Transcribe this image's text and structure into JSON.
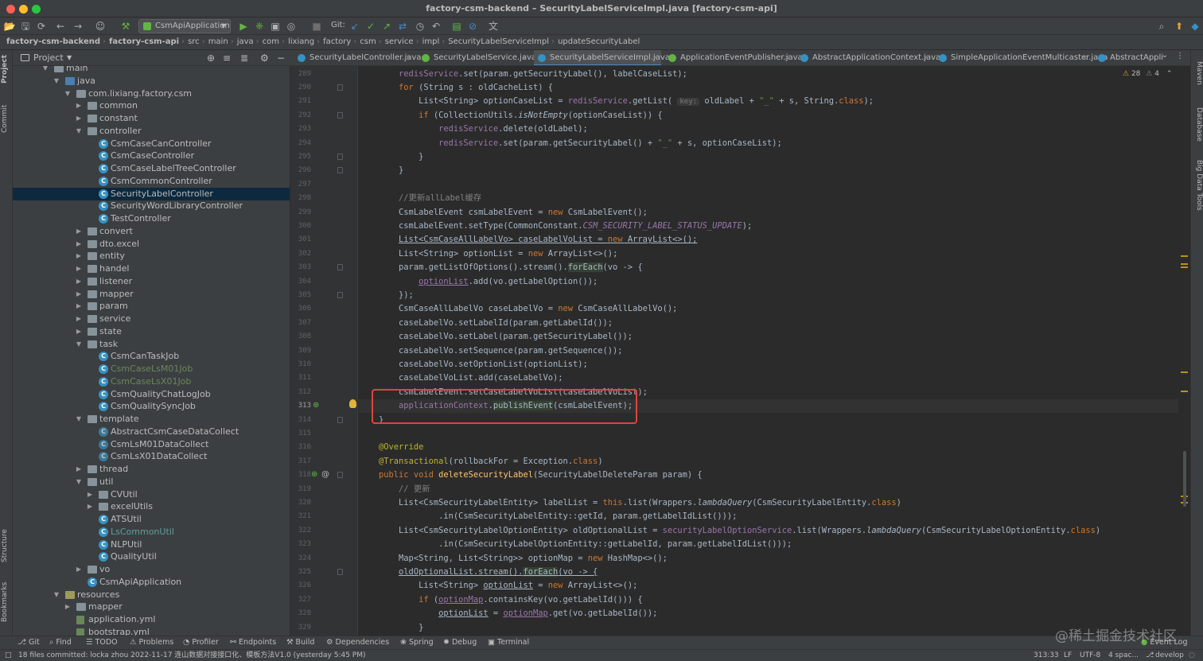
{
  "window": {
    "title": "factory-csm-backend – SecurityLabelServiceImpl.java [factory-csm-api]"
  },
  "toolbar": {
    "run_config": "CsmApiApplication",
    "git_label": "Git:"
  },
  "breadcrumbs": [
    "factory-csm-backend",
    "factory-csm-api",
    "src",
    "main",
    "java",
    "com",
    "lixiang",
    "factory",
    "csm",
    "service",
    "impl",
    "SecurityLabelServiceImpl",
    "updateSecurityLabel"
  ],
  "project": {
    "header": "Project",
    "tree": [
      {
        "label": "main",
        "kind": "folder",
        "level": 3
      },
      {
        "label": "java",
        "kind": "src",
        "level": 4
      },
      {
        "label": "com.lixiang.factory.csm",
        "kind": "folder",
        "level": 5
      },
      {
        "label": "common",
        "kind": "folder",
        "level": 6
      },
      {
        "label": "constant",
        "kind": "folder",
        "level": 6
      },
      {
        "label": "controller",
        "kind": "folder",
        "level": 6
      },
      {
        "label": "CsmCaseCanController",
        "kind": "class",
        "level": 7
      },
      {
        "label": "CsmCaseController",
        "kind": "class",
        "level": 7
      },
      {
        "label": "CsmCaseLabelTreeController",
        "kind": "class",
        "level": 7
      },
      {
        "label": "CsmCommonController",
        "kind": "class",
        "level": 7
      },
      {
        "label": "SecurityLabelController",
        "kind": "class",
        "level": 7,
        "selected": true
      },
      {
        "label": "SecurityWordLibraryController",
        "kind": "class",
        "level": 7
      },
      {
        "label": "TestController",
        "kind": "class",
        "level": 7
      },
      {
        "label": "convert",
        "kind": "folder",
        "level": 6
      },
      {
        "label": "dto.excel",
        "kind": "folder",
        "level": 6
      },
      {
        "label": "entity",
        "kind": "folder",
        "level": 6
      },
      {
        "label": "handel",
        "kind": "folder",
        "level": 6
      },
      {
        "label": "listener",
        "kind": "folder",
        "level": 6
      },
      {
        "label": "mapper",
        "kind": "folder",
        "level": 6
      },
      {
        "label": "param",
        "kind": "folder",
        "level": 6
      },
      {
        "label": "service",
        "kind": "folder",
        "level": 6
      },
      {
        "label": "state",
        "kind": "folder",
        "level": 6
      },
      {
        "label": "task",
        "kind": "folder",
        "level": 6
      },
      {
        "label": "CsmCanTaskJob",
        "kind": "class",
        "level": 7
      },
      {
        "label": "CsmCaseLsM01Job",
        "kind": "class",
        "level": 7,
        "color": "green"
      },
      {
        "label": "CsmCaseLsX01Job",
        "kind": "class",
        "level": 7,
        "color": "green"
      },
      {
        "label": "CsmQualityChatLogJob",
        "kind": "class",
        "level": 7
      },
      {
        "label": "CsmQualitySyncJob",
        "kind": "class",
        "level": 7
      },
      {
        "label": "template",
        "kind": "folder",
        "level": 6
      },
      {
        "label": "AbstractCsmCaseDataCollect",
        "kind": "abstract",
        "level": 7
      },
      {
        "label": "CsmLsM01DataCollect",
        "kind": "abstract",
        "level": 7
      },
      {
        "label": "CsmLsX01DataCollect",
        "kind": "abstract",
        "level": 7
      },
      {
        "label": "thread",
        "kind": "folder",
        "level": 6
      },
      {
        "label": "util",
        "kind": "folder",
        "level": 6
      },
      {
        "label": "CVUtil",
        "kind": "folder",
        "level": 7
      },
      {
        "label": "excelUtils",
        "kind": "folder",
        "level": 7
      },
      {
        "label": "ATSUtil",
        "kind": "class",
        "level": 7
      },
      {
        "label": "LsCommonUtil",
        "kind": "class",
        "level": 7,
        "color": "teal"
      },
      {
        "label": "NLPUtil",
        "kind": "class",
        "level": 7
      },
      {
        "label": "QualityUtil",
        "kind": "class",
        "level": 7
      },
      {
        "label": "vo",
        "kind": "folder",
        "level": 6
      },
      {
        "label": "CsmApiApplication",
        "kind": "class",
        "level": 6
      },
      {
        "label": "resources",
        "kind": "res",
        "level": 4
      },
      {
        "label": "mapper",
        "kind": "folder",
        "level": 5
      },
      {
        "label": "application.yml",
        "kind": "yml",
        "level": 5
      },
      {
        "label": "bootstrap.yml",
        "kind": "yml",
        "level": 5
      }
    ]
  },
  "tabs": [
    {
      "label": "SecurityLabelController.java",
      "icon": "class"
    },
    {
      "label": "SecurityLabelService.java",
      "icon": "interface"
    },
    {
      "label": "SecurityLabelServiceImpl.java",
      "icon": "class",
      "active": true
    },
    {
      "label": "ApplicationEventPublisher.java",
      "icon": "interface"
    },
    {
      "label": "AbstractApplicationContext.java",
      "icon": "class"
    },
    {
      "label": "SimpleApplicationEventMulticaster.java",
      "icon": "class"
    },
    {
      "label": "AbstractAppli",
      "icon": "class"
    }
  ],
  "inspections": {
    "warnings": "28",
    "weak": "4"
  },
  "editor": {
    "current_line": 313,
    "lines": [
      {
        "n": 289,
        "html": "        <span class='fld'>redisService</span>.set(param.getSecurityLabel(), labelCaseList);"
      },
      {
        "n": 290,
        "html": "        <span class='kw'>for</span> (String s : oldCacheList) {"
      },
      {
        "n": 291,
        "html": "            List&lt;String&gt; optionCaseList = <span class='fld'>redisService</span>.getList( <span class='hint'>key:</span> oldLabel + <span class='str'>\"_\"</span> + s, String.<span class='kw'>class</span>);"
      },
      {
        "n": 292,
        "html": "            <span class='kw'>if</span> (CollectionUtils.<span class='sti'>isNotEmpty</span>(optionCaseList)) {"
      },
      {
        "n": 293,
        "html": "                <span class='fld'>redisService</span>.delete(oldLabel);"
      },
      {
        "n": 294,
        "html": "                <span class='fld'>redisService</span>.set(param.getSecurityLabel() + <span class='str'>\"_\"</span> + s, optionCaseList);"
      },
      {
        "n": 295,
        "html": "            }"
      },
      {
        "n": 296,
        "html": "        }"
      },
      {
        "n": 297,
        "html": ""
      },
      {
        "n": 298,
        "html": "        <span class='cmt'>//更新allLabel缓存</span>"
      },
      {
        "n": 299,
        "html": "        CsmLabelEvent csmLabelEvent = <span class='kw'>new</span> CsmLabelEvent();"
      },
      {
        "n": 300,
        "html": "        csmLabelEvent.setType(CommonConstant.<span class='fldi'>CSM_SECURITY_LABEL_STATUS_UPDATE</span>);"
      },
      {
        "n": 301,
        "html": "        <span class='und'>List&lt;CsmCaseAllLabelVo&gt; caseLabelVoList = <span class='kw'>new</span> ArrayList&lt;&gt;();</span>"
      },
      {
        "n": 302,
        "html": "        List&lt;String&gt; optionList = <span class='kw'>new</span> ArrayList&lt;&gt;();"
      },
      {
        "n": 303,
        "html": "        param.getListOfOptions().stream().<span class='hl'>forEach</span>(vo -&gt; {"
      },
      {
        "n": 304,
        "html": "            <span class='fld und'>optionList</span>.add(vo.getLabelOption());"
      },
      {
        "n": 305,
        "html": "        });"
      },
      {
        "n": 306,
        "html": "        CsmCaseAllLabelVo caseLabelVo = <span class='kw'>new</span> CsmCaseAllLabelVo();"
      },
      {
        "n": 307,
        "html": "        caseLabelVo.setLabelId(param.getLabelId());"
      },
      {
        "n": 308,
        "html": "        caseLabelVo.setLabel(param.getSecurityLabel());"
      },
      {
        "n": 309,
        "html": "        caseLabelVo.setSequence(param.getSequence());"
      },
      {
        "n": 310,
        "html": "        caseLabelVo.setOptionList(optionList);"
      },
      {
        "n": 311,
        "html": "        caseLabelVoList.add(caseLabelVo);"
      },
      {
        "n": 312,
        "html": "        csmLabelEvent.setCaseLabelVoList(caseLabelVoList);"
      },
      {
        "n": 313,
        "html": "        <span class='fld'>applicationContext</span>.<span class='hl'>publishEvent</span>(csmLabelEvent);"
      },
      {
        "n": 314,
        "html": "    }"
      },
      {
        "n": 315,
        "html": ""
      },
      {
        "n": 316,
        "html": "    <span class='ann'>@Override</span>"
      },
      {
        "n": 317,
        "html": "    <span class='ann'>@Transactional</span>(rollbackFor = Exception.<span class='kw'>class</span>)"
      },
      {
        "n": 318,
        "html": "    <span class='kw'>public void</span> <span class='met'>deleteSecurityLabel</span>(SecurityLabelDeleteParam param) {"
      },
      {
        "n": 319,
        "html": "        <span class='cmt'>// 更新</span>"
      },
      {
        "n": 320,
        "html": "        List&lt;CsmSecurityLabelEntity&gt; labelList = <span class='kw'>this</span>.list(Wrappers.<span class='sti'>lambdaQuery</span>(CsmSecurityLabelEntity.<span class='kw'>class</span>)"
      },
      {
        "n": 321,
        "html": "                .in(CsmSecurityLabelEntity::getId, param.getLabelIdList()));"
      },
      {
        "n": 322,
        "html": "        List&lt;CsmSecurityLabelOptionEntity&gt; oldOptionalList = <span class='fld'>securityLabelOptionService</span>.list(Wrappers.<span class='sti'>lambdaQuery</span>(CsmSecurityLabelOptionEntity.<span class='kw'>class</span>)"
      },
      {
        "n": 323,
        "html": "                .in(CsmSecurityLabelOptionEntity::getLabelId, param.getLabelIdList()));"
      },
      {
        "n": 324,
        "html": "        Map&lt;String, List&lt;String&gt;&gt; optionMap = <span class='kw'>new</span> HashMap&lt;&gt;();"
      },
      {
        "n": 325,
        "html": "        <span class='und'>oldOptionalList.stream().<span class='hl'>forEach</span>(vo -&gt; {</span>"
      },
      {
        "n": 326,
        "html": "            List&lt;String&gt; <span class='und'>optionList</span> = <span class='kw'>new</span> ArrayList&lt;&gt;();"
      },
      {
        "n": 327,
        "html": "            <span class='kw'>if</span> (<span class='fld und'>optionMap</span>.containsKey(vo.getLabelId())) {"
      },
      {
        "n": 328,
        "html": "                <span class='und'>optionList</span> = <span class='fld und'>optionMap</span>.get(vo.getLabelId());"
      },
      {
        "n": 329,
        "html": "            }"
      }
    ]
  },
  "bottom_tools": [
    {
      "label": "Git",
      "icon": "branch-icon"
    },
    {
      "label": "Find",
      "icon": "search-icon"
    },
    {
      "label": "TODO",
      "icon": "list-icon"
    },
    {
      "label": "Problems",
      "icon": "warning-icon"
    },
    {
      "label": "Profiler",
      "icon": "profiler-icon"
    },
    {
      "label": "Endpoints",
      "icon": "endpoints-icon"
    },
    {
      "label": "Build",
      "icon": "hammer-icon"
    },
    {
      "label": "Dependencies",
      "icon": "dependencies-icon"
    },
    {
      "label": "Spring",
      "icon": "spring-icon"
    },
    {
      "label": "Debug",
      "icon": "bug-icon"
    },
    {
      "label": "Terminal",
      "icon": "terminal-icon"
    }
  ],
  "event_log": "Event Log",
  "status": {
    "message": "18 files committed: locka zhou 2022-11-17 连山数据对接接口化、模板方法V1.0 (yesterday 5:45 PM)",
    "position": "313:33",
    "line_sep": "LF",
    "encoding": "UTF-8",
    "indent": "4 spac...",
    "branch": "develop"
  },
  "side_tools": {
    "left": [
      "Project",
      "Commit",
      "Structure",
      "Bookmarks"
    ],
    "right": [
      "Maven",
      "Database",
      "Big Data Tools"
    ]
  },
  "watermark": "@稀土掘金技术社区"
}
